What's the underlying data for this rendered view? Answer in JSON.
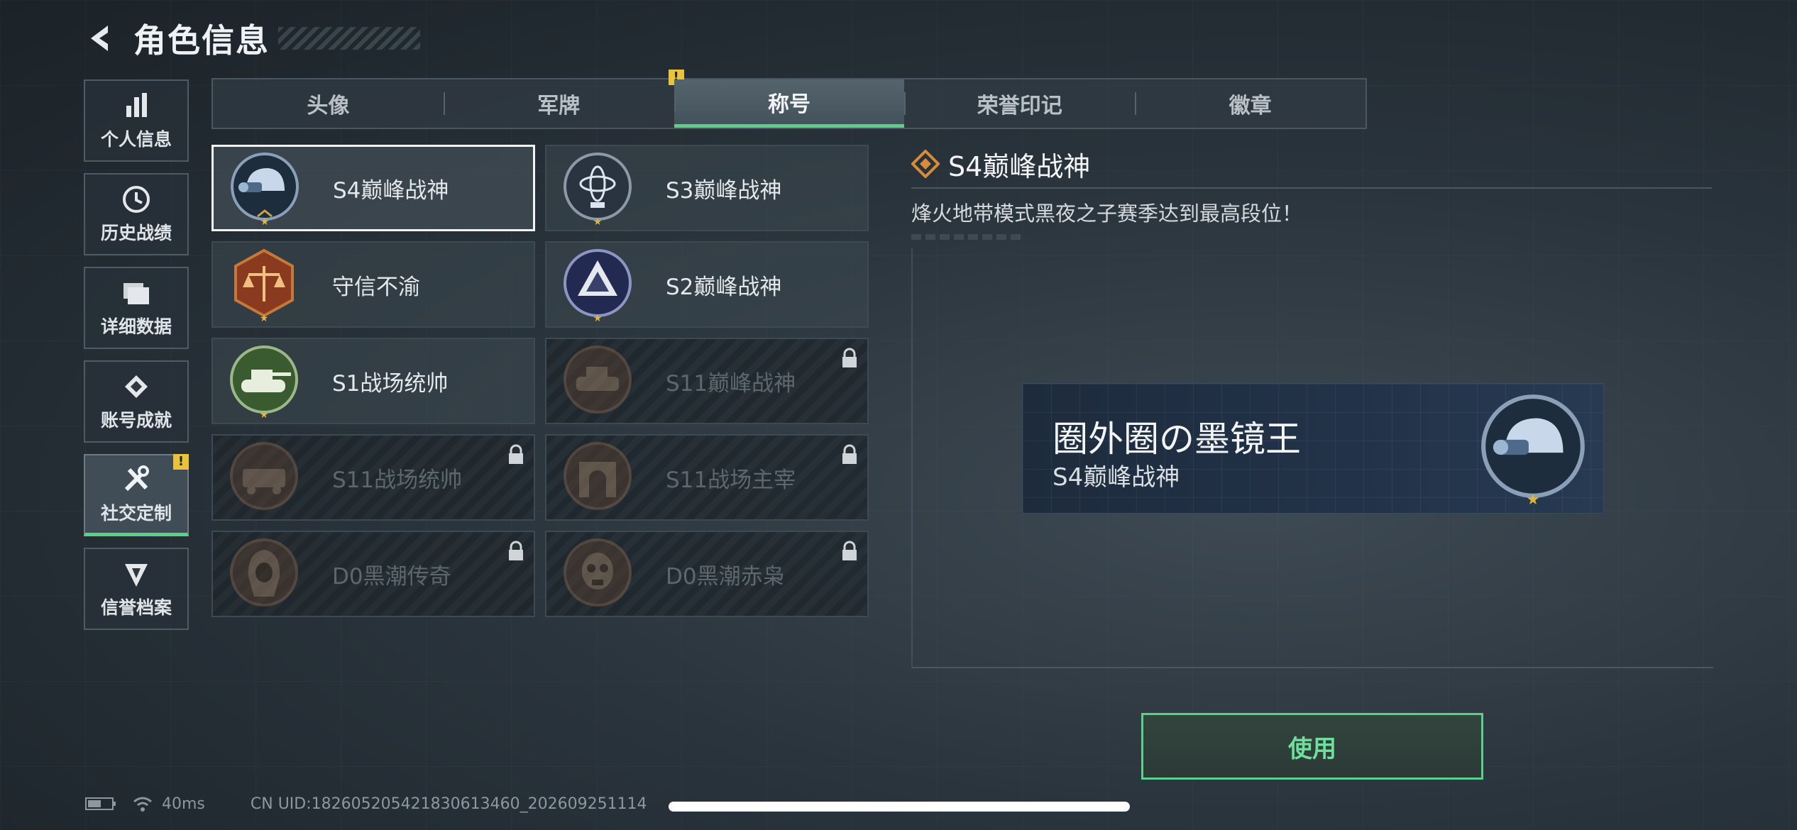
{
  "header": {
    "title": "角色信息",
    "back_icon": "back-arrow-icon"
  },
  "sidebar": {
    "items": [
      {
        "label": "个人信息",
        "icon": "bar-chart-icon",
        "active": false
      },
      {
        "label": "历史战绩",
        "icon": "clock-icon",
        "active": false
      },
      {
        "label": "详细数据",
        "icon": "folders-icon",
        "active": false
      },
      {
        "label": "账号成就",
        "icon": "medal-icon",
        "active": false
      },
      {
        "label": "社交定制",
        "icon": "tools-icon",
        "active": true,
        "badge": "!"
      },
      {
        "label": "信誉档案",
        "icon": "shield-icon",
        "active": false
      }
    ]
  },
  "tabs": [
    {
      "label": "头像",
      "active": false
    },
    {
      "label": "军牌",
      "active": false,
      "badge": "!"
    },
    {
      "label": "称号",
      "active": true
    },
    {
      "label": "荣誉印记",
      "active": false
    },
    {
      "label": "徽章",
      "active": false
    }
  ],
  "titles": [
    {
      "label": "S4巅峰战神",
      "locked": false,
      "selected": true,
      "emblem": "helmet-emblem-icon"
    },
    {
      "label": "S3巅峰战神",
      "locked": false,
      "selected": false,
      "emblem": "gyroscope-emblem-icon"
    },
    {
      "label": "守信不渝",
      "locked": false,
      "selected": false,
      "emblem": "scales-emblem-icon"
    },
    {
      "label": "S2巅峰战神",
      "locked": false,
      "selected": false,
      "emblem": "triangle-emblem-icon"
    },
    {
      "label": "S1战场统帅",
      "locked": false,
      "selected": false,
      "emblem": "tank-emblem-icon"
    },
    {
      "label": "S11巅峰战神",
      "locked": true,
      "selected": false,
      "emblem": "vehicle-emblem-icon"
    },
    {
      "label": "S11战场统帅",
      "locked": true,
      "selected": false,
      "emblem": "apc-emblem-icon"
    },
    {
      "label": "S11战场主宰",
      "locked": true,
      "selected": false,
      "emblem": "arch-emblem-icon"
    },
    {
      "label": "D0黑潮传奇",
      "locked": true,
      "selected": false,
      "emblem": "hooded-figure-emblem-icon"
    },
    {
      "label": "D0黑潮赤枭",
      "locked": true,
      "selected": false,
      "emblem": "skull-mask-emblem-icon"
    }
  ],
  "detail": {
    "title": "S4巅峰战神",
    "description": "烽火地带模式黑夜之子赛季达到最高段位！",
    "nameplate": {
      "player_name": "圈外圈の墨镜王",
      "title": "S4巅峰战神",
      "emblem": "helmet-emblem-icon"
    },
    "use_button": "使用"
  },
  "footer": {
    "ping": "40ms",
    "uid": "CN UID:1826052054218306134​60_20260925111​4"
  },
  "colors": {
    "accent_green": "#5bd08a",
    "warning_yellow": "#e9c43a",
    "diamond_orange": "#d98a3a"
  }
}
